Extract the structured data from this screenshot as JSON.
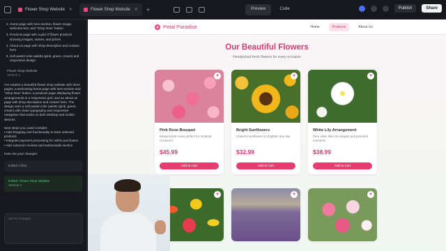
{
  "tabs": [
    {
      "label": "Flower Shop Website",
      "active": false
    },
    {
      "label": "Flower Shop Website",
      "active": true
    }
  ],
  "toolbar": {
    "preview_label": "Preview",
    "code_label": "Code",
    "publish_label": "Publish",
    "share_label": "Share"
  },
  "chat": {
    "plan_items": [
      "Home page with hero section, flower image, welcome text, and \"Shop Now\" button",
      "Products page with a grid of flower products showing images, names, and prices",
      "About Us page with shop description and contact form",
      "Soft pastel color palette (pink, green, cream) and responsive design"
    ],
    "version_title": "Flower Shop Website",
    "version_sub": "Version 1",
    "summary": "I've created a beautiful flower shop website with three pages: a welcoming home page with hero section and \"Shop Now\" button, a products page displaying flower arrangements in a responsive grid, and an about us page with shop description and contact form. The design uses a soft pastel color palette (pink, green, cream) with clean typography and responsive navigation that works on both desktop and mobile devices.",
    "next_title": "Next steps you could consider:",
    "next_1": "• Add shopping cart functionality to track selected products",
    "next_2": "• Integrate payment processing for online purchases",
    "next_3": "• Add customer reviews and testimonials section",
    "changes_label": "Here are your changes:",
    "edited_files": "Edited 2 files",
    "edit_title": "Edited: Flower Shop Website",
    "edit_sub": "Version 2",
    "input_placeholder": "Ask for changes..."
  },
  "site": {
    "brand": "Petal Paradise",
    "nav": [
      "Home",
      "Products",
      "About Us"
    ],
    "active_nav": "Products",
    "title": "Our Beautiful Flowers",
    "subtitle": "Handpicked fresh flowers for every occasion",
    "cart_label": "Add to Cart",
    "products": [
      {
        "name": "Pink Rose Bouquet",
        "desc": "Elegant pink roses perfect for romantic occasions",
        "price": "$45.99"
      },
      {
        "name": "Bright Sunflowers",
        "desc": "Cheerful sunflowers to brighten any day",
        "price": "$32.99"
      },
      {
        "name": "White Lily Arrangement",
        "desc": "Pure white lilies for elegant and peaceful moments",
        "price": "$38.99"
      }
    ]
  },
  "colors": {
    "brand_pink": "#d63a6e",
    "button": "#e63d71"
  }
}
